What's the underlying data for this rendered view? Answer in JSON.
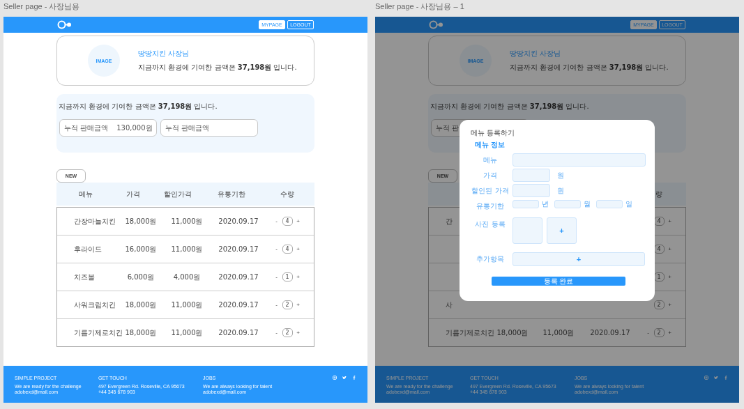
{
  "frames": [
    {
      "title": "Seller page - 사장님용",
      "header": {
        "buttons": [
          "MYPAGE",
          "LOGOUT"
        ]
      },
      "profile": {
        "image_label": "IMAGE",
        "name": "땅땅치킨 사장님",
        "message": "지금까지 환경에 기여한 금액은 **37,198원** 입니다."
      },
      "summary": {
        "message": "지금까지 환경에 기여한 금액은 **37,198원** 입니다.",
        "stats": [
          {
            "label": "누적 판매금액",
            "value": "130,000원"
          },
          {
            "label": "누적 판매금액"
          }
        ]
      },
      "new_button": "NEW",
      "table": {
        "header": {
          "menu": "메뉴",
          "price": "가격",
          "discount": "할인가격",
          "expiry": "유통기한",
          "quantity": "수량"
        },
        "rows": [
          {
            "menu": "간장마늘치킨",
            "price": "18,000원",
            "discount": "11,000원",
            "expiry": "2020.09.17",
            "minus": "-",
            "quantity": "4",
            "plus": "+"
          },
          {
            "menu": "후라이드",
            "price": "16,000원",
            "discount": "11,000원",
            "expiry": "2020.09.17",
            "minus": "-",
            "quantity": "4",
            "plus": "+"
          },
          {
            "menu": "치즈볼",
            "price": "6,000원",
            "discount": "4,000원",
            "expiry": "2020.09.17",
            "minus": "-",
            "quantity": "1",
            "plus": "+"
          },
          {
            "menu": "사워크림치킨",
            "price": "18,000원",
            "discount": "11,000원",
            "expiry": "2020.09.17",
            "minus": "-",
            "quantity": "2",
            "plus": "+"
          },
          {
            "menu": "기름기제로치킨",
            "price": "18,000원",
            "discount": "11,000원",
            "expiry": "2020.09.17",
            "minus": "-",
            "quantity": "2",
            "plus": "+"
          }
        ]
      },
      "footer": {
        "columns": [
          {
            "heading": "SIMPLE PROJECT",
            "lines": [
              "We are ready for the challenge",
              "adobexd@mail.com"
            ]
          },
          {
            "heading": "GET TOUCH",
            "lines": [
              "497 Evergreen Rd. Roseville, CA 95673",
              "+44 345 678 903"
            ]
          },
          {
            "heading": "JOBS",
            "lines": [
              "We are always looking for talent",
              "adobexd@mail.com"
            ]
          }
        ]
      }
    },
    {
      "title": "Seller page - 사장님용 – 1",
      "header": {
        "buttons": [
          "MYPAGE",
          "LOGOUT"
        ]
      },
      "profile": {
        "image_label": "IMAGE",
        "name": "땅땅치킨 사장님",
        "message": "지금까지 환경에 기여한 금액은 **37,198원** 입니다."
      },
      "summary": {
        "message": "지금까지 환경에 기여한 금액은 **37,198원** 입니다.",
        "stats": [
          {
            "label": "누적 판"
          }
        ]
      },
      "new_button": "NEW",
      "table": {
        "header": {
          "quantity": "량"
        },
        "rows": [
          {
            "menu": "간",
            "quantity": "4",
            "plus": "+"
          },
          {
            "quantity": "4",
            "plus": "+"
          },
          {
            "quantity": "1",
            "plus": "+"
          },
          {
            "menu": "사",
            "quantity": "2",
            "plus": "+"
          },
          {
            "menu": "기름기제로치킨",
            "price": "18,000원",
            "discount": "11,000원",
            "expiry": "2020.09.17",
            "minus": "-",
            "quantity": "2",
            "plus": "+"
          }
        ]
      },
      "footer": {
        "columns": [
          {
            "heading": "SIMPLE PROJECT",
            "lines": [
              "We are ready for the challenge",
              "adobexd@mail.com"
            ]
          },
          {
            "heading": "GET TOUCH",
            "lines": [
              "497 Evergreen Rd. Roseville, CA 95673",
              "+44 345 678 903"
            ]
          },
          {
            "heading": "JOBS",
            "lines": [
              "We are always looking for talent",
              "adobexd@mail.com"
            ]
          }
        ]
      },
      "modal": {
        "title": "메뉴 등록하기",
        "section": "메뉴 정보",
        "rows": [
          {
            "kind": "text",
            "label": "메뉴"
          },
          {
            "kind": "price",
            "label": "가격",
            "unit": "원"
          },
          {
            "kind": "price",
            "label": "할인된 가격",
            "unit": "원"
          },
          {
            "kind": "date",
            "label": "유통기한",
            "units": [
              "년",
              "월",
              "일"
            ]
          },
          {
            "kind": "photos",
            "label": "사진 등록",
            "add": "+"
          },
          {
            "kind": "add",
            "label": "추가항목",
            "add": "+"
          }
        ],
        "submit": "등록 완료"
      }
    }
  ]
}
